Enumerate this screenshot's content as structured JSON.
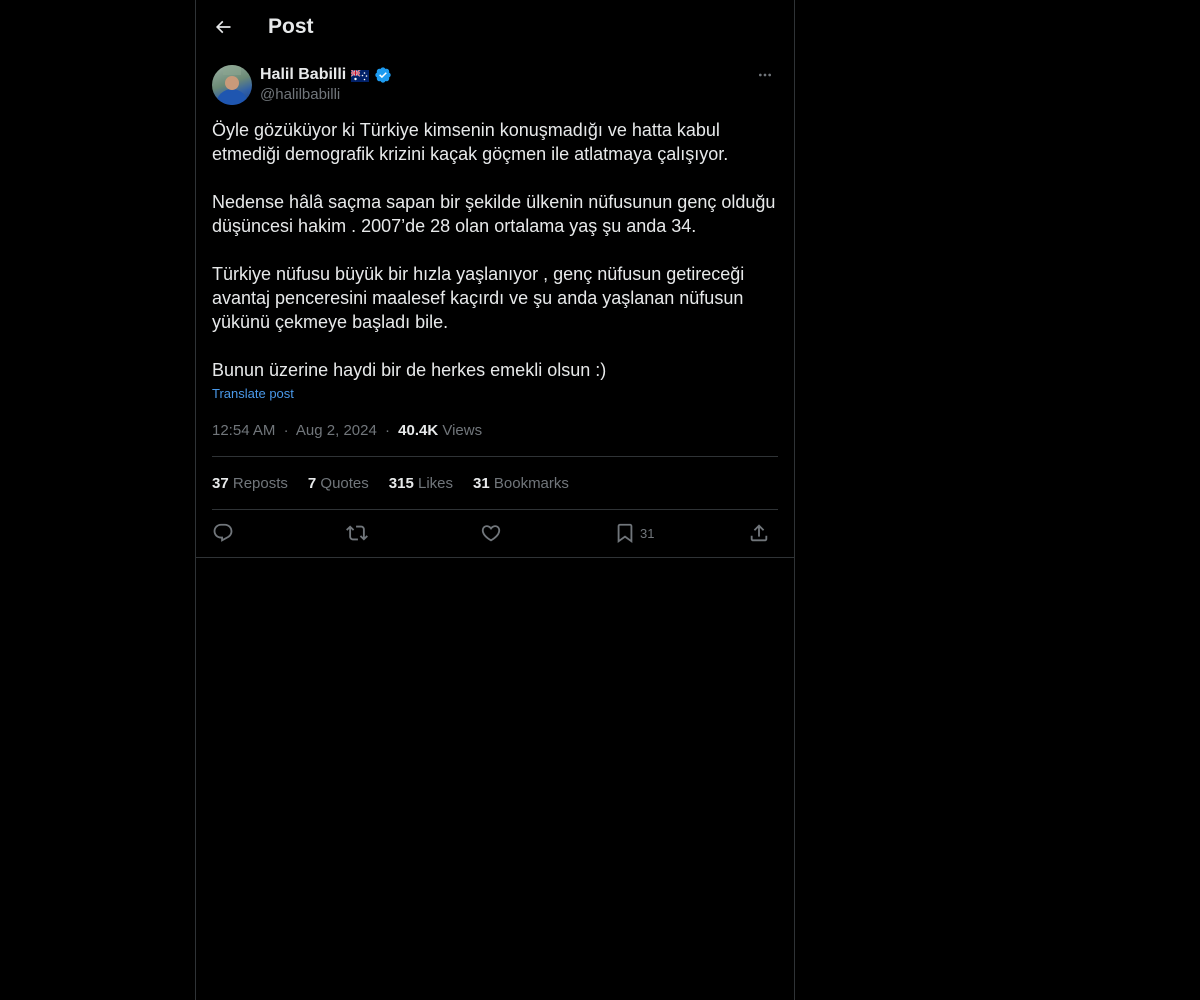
{
  "header": {
    "title": "Post",
    "back_icon": "arrow-left-icon"
  },
  "author": {
    "name": "Halil Babilli",
    "flag": "🇦🇺",
    "handle": "@halilbabilli",
    "verified": true,
    "verified_color": "#1d9bf0"
  },
  "post": {
    "paragraphs": [
      "Öyle gözüküyor ki Türkiye kimsenin konuşmadığı ve hatta kabul etmediği demografik krizini kaçak göçmen ile atlatmaya çalışıyor.",
      "Nedense hâlâ saçma sapan bir şekilde ülkenin nüfusunun genç olduğu düşüncesi hakim . 2007’de 28 olan ortalama yaş şu anda 34.",
      "Türkiye nüfusu büyük bir hızla yaşlanıyor , genç nüfusun getireceği avantaj penceresini maalesef kaçırdı ve şu anda yaşlanan nüfusun yükünü çekmeye başladı bile.",
      "Bunun üzerine haydi bir de herkes emekli olsun  :)"
    ],
    "translate_label": "Translate post",
    "time": "12:54 AM",
    "separator": "·",
    "date": "Aug 2, 2024",
    "views_count": "40.4K",
    "views_label": "Views"
  },
  "stats": {
    "reposts_count": "37",
    "reposts_label": "Reposts",
    "quotes_count": "7",
    "quotes_label": "Quotes",
    "likes_count": "315",
    "likes_label": "Likes",
    "bookmarks_count": "31",
    "bookmarks_label": "Bookmarks"
  },
  "actions": {
    "reply_icon": "reply-icon",
    "repost_icon": "repost-icon",
    "like_icon": "heart-icon",
    "bookmark_icon": "bookmark-icon",
    "bookmark_count": "31",
    "share_icon": "share-icon"
  },
  "colors": {
    "background": "#000000",
    "text": "#e7e9ea",
    "secondary": "#71767b",
    "link": "#4a99e9",
    "border": "#2f3336"
  }
}
